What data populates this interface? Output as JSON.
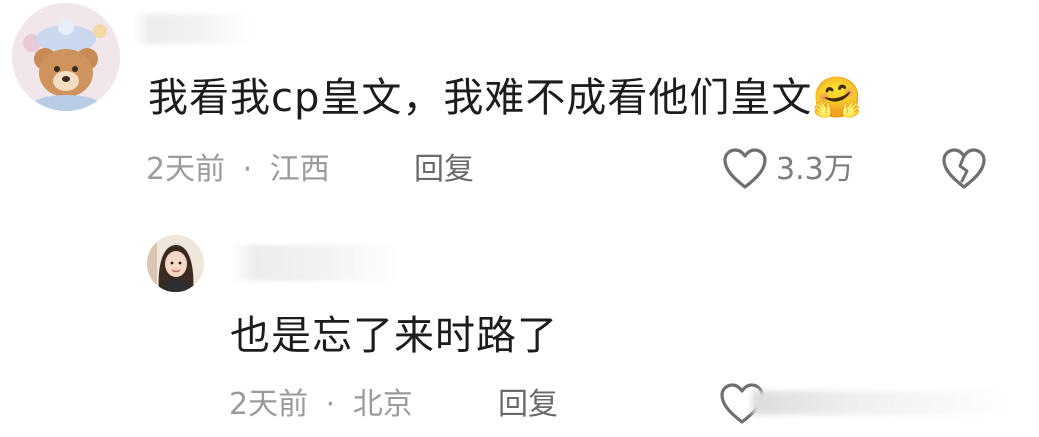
{
  "comments": [
    {
      "text": "我看我cp皇文，我难不成看他们皇文",
      "emoji": "🤗",
      "time": "2天前",
      "separator": "·",
      "location": "江西",
      "reply_label": "回复",
      "likes": "3.3万",
      "icons": [
        "heart-outline-icon",
        "broken-heart-icon"
      ]
    },
    {
      "text": "也是忘了来时路了",
      "time": "2天前",
      "separator": "·",
      "location": "北京",
      "reply_label": "回复",
      "icons": [
        "heart-outline-icon"
      ]
    }
  ],
  "colors": {
    "text": "#1c1c1c",
    "meta": "#9b9b9b",
    "icon": "#6f6f6f"
  }
}
